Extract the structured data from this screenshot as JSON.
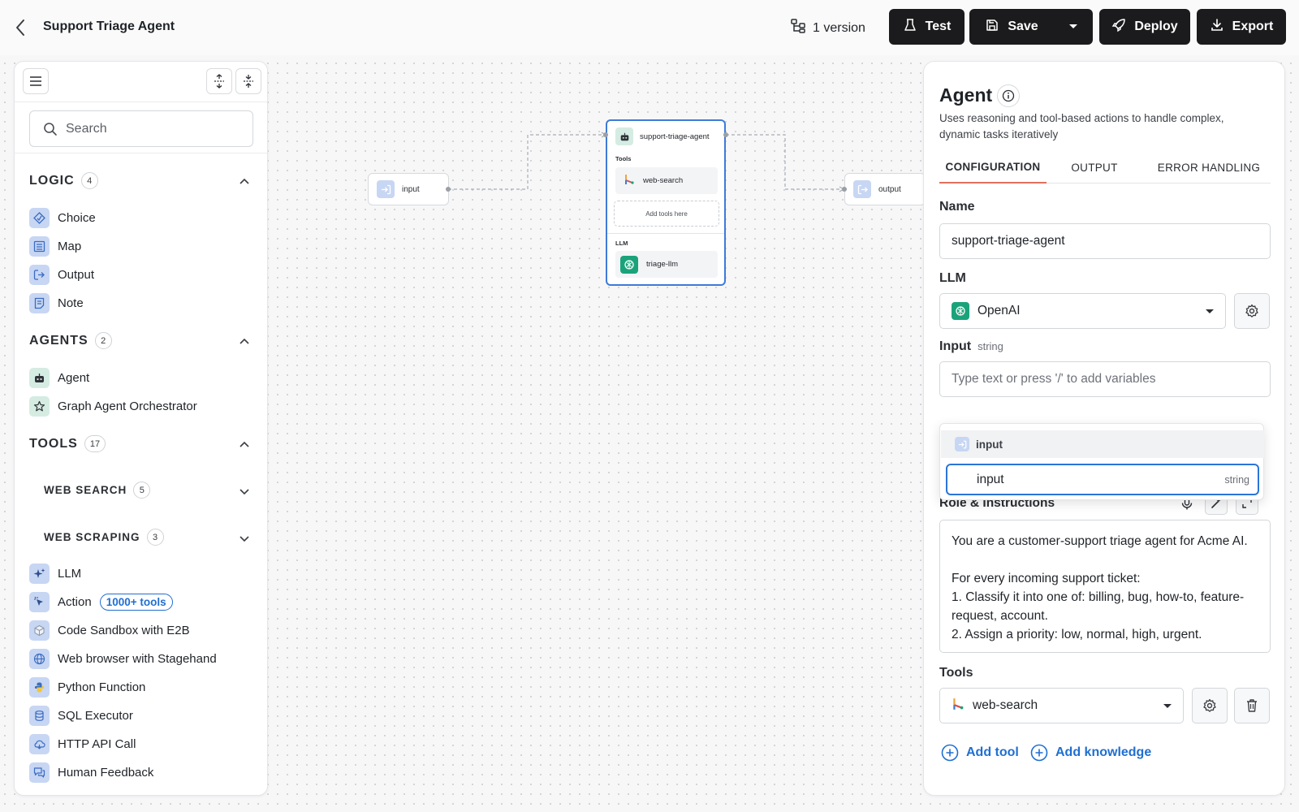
{
  "header": {
    "title": "Support Triage Agent",
    "version_label": "1 version",
    "test_label": "Test",
    "save_label": "Save",
    "deploy_label": "Deploy",
    "export_label": "Export"
  },
  "sidebar": {
    "search_placeholder": "Search",
    "sections": {
      "logic": {
        "title": "LOGIC",
        "count": "4",
        "items": [
          "Choice",
          "Map",
          "Output",
          "Note"
        ]
      },
      "agents": {
        "title": "AGENTS",
        "count": "2",
        "items": [
          "Agent",
          "Graph Agent Orchestrator"
        ]
      },
      "tools": {
        "title": "TOOLS",
        "count": "17",
        "groups": [
          {
            "title": "WEB SEARCH",
            "count": "5"
          },
          {
            "title": "WEB SCRAPING",
            "count": "3"
          }
        ],
        "items": [
          "LLM",
          "Action",
          "Code Sandbox with E2B",
          "Web browser with Stagehand",
          "Python Function",
          "SQL Executor",
          "HTTP API Call",
          "Human Feedback"
        ],
        "action_badge": "1000+ tools"
      }
    }
  },
  "canvas": {
    "input_node": "input",
    "output_node": "output",
    "agent_node": {
      "name": "support-triage-agent",
      "tools_label": "Tools",
      "tool": "web-search",
      "add_tools": "Add tools here",
      "llm_label": "LLM",
      "llm": "triage-llm"
    }
  },
  "panel": {
    "title": "Agent",
    "description": "Uses reasoning and tool-based actions to handle complex, dynamic tasks iteratively",
    "tabs": [
      "CONFIGURATION",
      "OUTPUT",
      "ERROR HANDLING"
    ],
    "name_label": "Name",
    "name_value": "support-triage-agent",
    "llm_label": "LLM",
    "llm_value": "OpenAI",
    "input_label": "Input",
    "input_type": "string",
    "input_placeholder": "Type text or press '/' to add variables",
    "dropdown": {
      "group": "input",
      "option": "input",
      "option_type": "string"
    },
    "role_label": "Role & Instructions",
    "role_text": "You are a customer-support triage agent for Acme AI.\n\nFor every incoming support ticket:\n1. Classify it into one of: billing, bug, how-to, feature-request, account.\n2. Assign a priority: low, normal, high, urgent.",
    "tools_label": "Tools",
    "tool_value": "web-search",
    "add_tool": "Add tool",
    "add_knowledge": "Add knowledge"
  },
  "colors": {
    "accent": "#1f6fd1",
    "selected_border": "#3d7bd9",
    "tab_underline": "#e0705a",
    "button_dark": "#1b1b1d"
  }
}
